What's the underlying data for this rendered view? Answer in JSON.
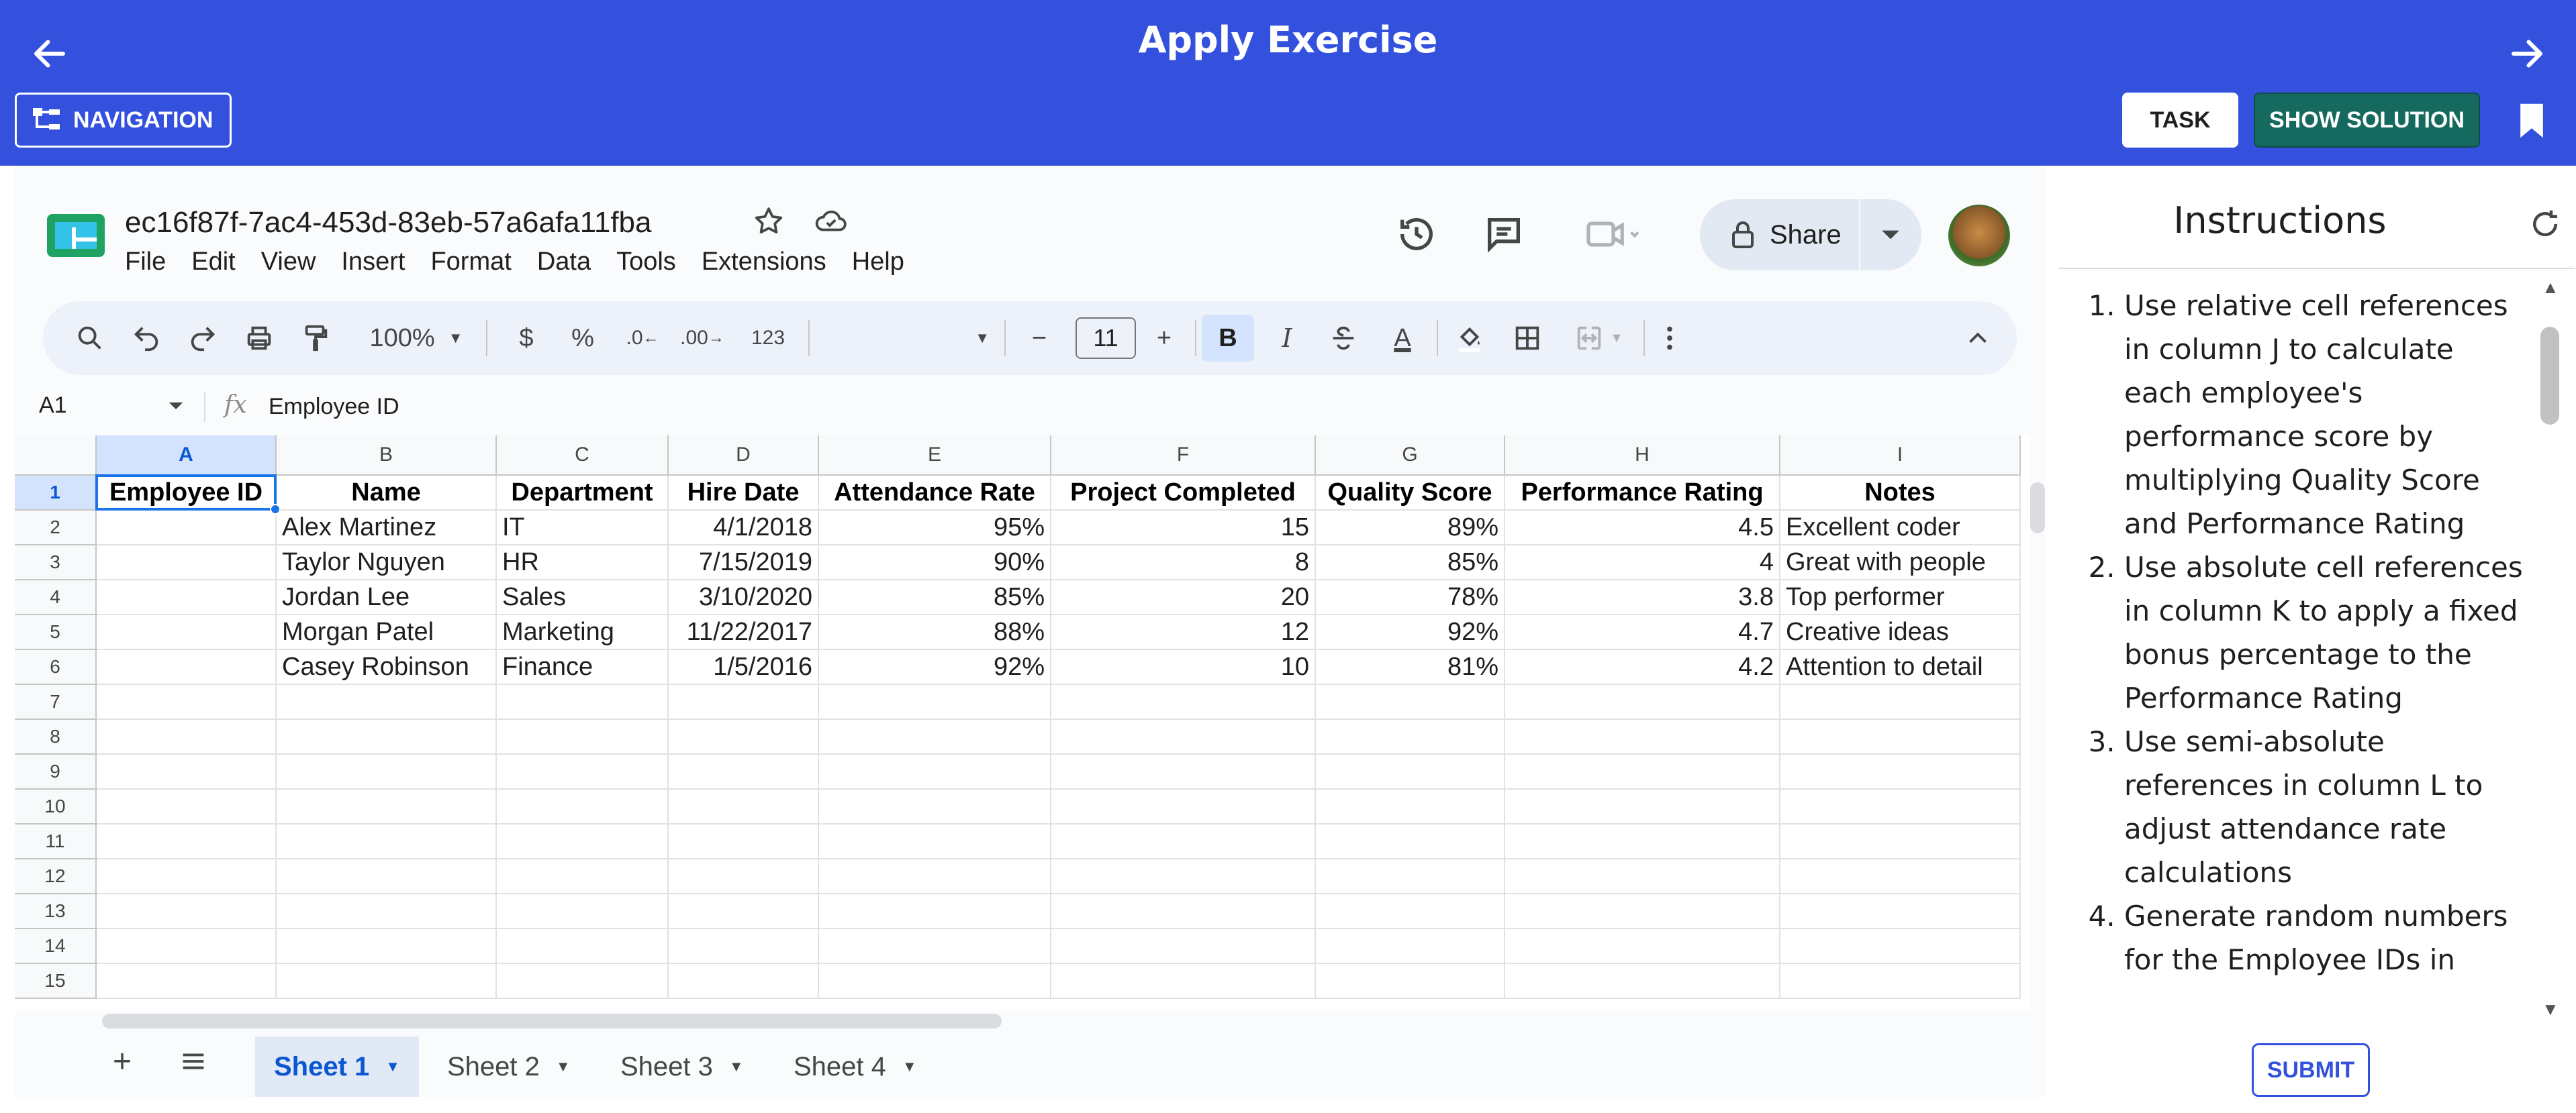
{
  "app": {
    "title": "Apply Exercise",
    "navigation_label": "NAVIGATION",
    "task_label": "TASK",
    "show_solution_label": "SHOW SOLUTION",
    "accent_color": "#3451de",
    "solution_color": "#15695e"
  },
  "doc": {
    "title": "ec16f87f-7ac4-453d-83eb-57a6afa11fba",
    "menu": [
      "File",
      "Edit",
      "View",
      "Insert",
      "Format",
      "Data",
      "Tools",
      "Extensions",
      "Help"
    ],
    "share_label": "Share"
  },
  "toolbar": {
    "zoom": "100%",
    "currency": "$",
    "percent": "%",
    "dec_decrease": ".0",
    "dec_increase": ".00",
    "number_format": "123",
    "font_size": "11",
    "bold": "B",
    "italic": "I",
    "text_color": "A"
  },
  "formula_bar": {
    "name_box": "A1",
    "fx": "fx",
    "content": "Employee ID"
  },
  "sheet": {
    "columns": [
      "A",
      "B",
      "C",
      "D",
      "E",
      "F",
      "G",
      "H",
      "I"
    ],
    "row_numbers": [
      "1",
      "2",
      "3",
      "4",
      "5",
      "6",
      "7",
      "8",
      "9",
      "10",
      "11",
      "12",
      "13",
      "14",
      "15"
    ],
    "header": [
      "Employee ID",
      "Name",
      "Department",
      "Hire Date",
      "Attendance Rate",
      "Project Completed",
      "Quality Score",
      "Performance Rating",
      "Notes"
    ],
    "rows": [
      [
        "",
        "Alex Martinez",
        "IT",
        "4/1/2018",
        "95%",
        "15",
        "89%",
        "4.5",
        "Excellent coder"
      ],
      [
        "",
        "Taylor Nguyen",
        "HR",
        "7/15/2019",
        "90%",
        "8",
        "85%",
        "4",
        "Great with people"
      ],
      [
        "",
        "Jordan Lee",
        "Sales",
        "3/10/2020",
        "85%",
        "20",
        "78%",
        "3.8",
        "Top performer"
      ],
      [
        "",
        "Morgan Patel",
        "Marketing",
        "11/22/2017",
        "88%",
        "12",
        "92%",
        "4.7",
        "Creative ideas"
      ],
      [
        "",
        "Casey Robinson",
        "Finance",
        "1/5/2016",
        "92%",
        "10",
        "81%",
        "4.2",
        "Attention to detail"
      ]
    ],
    "tabs": [
      "Sheet 1",
      "Sheet 2",
      "Sheet 3",
      "Sheet 4"
    ],
    "active_tab": "Sheet 1"
  },
  "instructions": {
    "title": "Instructions",
    "items": [
      "Use relative cell references in column J to calculate each employee's performance score by multiplying Quality Score and Performance Rating",
      "Use absolute cell references in column K to apply a fixed bonus percentage to the Performance Rating",
      "Use semi-absolute references in column L to adjust attendance rate calculations",
      "Generate random numbers for the Employee IDs in"
    ],
    "submit_label": "SUBMIT"
  }
}
